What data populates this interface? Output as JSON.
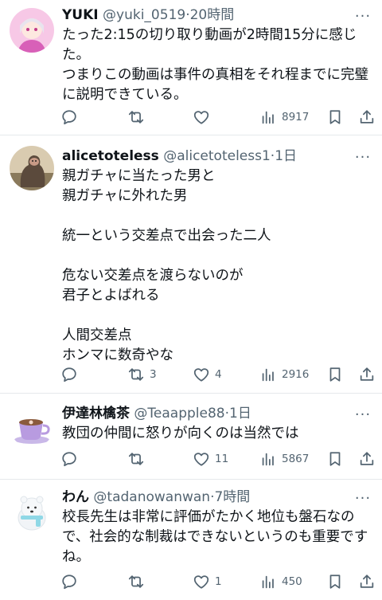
{
  "tweets": [
    {
      "name": "YUKI",
      "handle": "@yuki_0519",
      "time": "20時間",
      "lines": [
        "たった2:15の切り取り動画が2時間15分に感じ",
        "た。",
        "つまりこの動画は事件の真相をそれ程までに完璧",
        "に説明できている。"
      ],
      "replies": "",
      "retweets": "",
      "likes": "",
      "views": "8917"
    },
    {
      "name": "alicetoteless",
      "handle": "@alicetoteless1",
      "time": "1日",
      "lines": [
        "親ガチャに当たった男と",
        "親ガチャに外れた男",
        "",
        "統一という交差点で出会った二人",
        "",
        "危ない交差点を渡らないのが",
        "君子とよばれる",
        "",
        "人間交差点",
        "ホンマに数奇やな"
      ],
      "replies": "",
      "retweets": "3",
      "likes": "4",
      "views": "2916"
    },
    {
      "name": "伊達林檎茶",
      "handle": "@Teaapple88",
      "time": "1日",
      "lines": [
        "教団の仲間に怒りが向くのは当然では"
      ],
      "replies": "",
      "retweets": "",
      "likes": "11",
      "views": "5867"
    },
    {
      "name": "わん",
      "handle": "@tadanowanwan",
      "time": "7時間",
      "lines": [
        "校長先生は非常に評価がたかく地位も盤石なの",
        "で、社会的な制裁はできないというのも重要です",
        "ね。"
      ],
      "replies": "",
      "retweets": "",
      "likes": "1",
      "views": "450"
    }
  ],
  "separator": "·",
  "icons": [
    "reply-icon",
    "retweet-icon",
    "like-icon",
    "views-icon",
    "bookmark-icon",
    "share-icon",
    "more-icon"
  ],
  "colors": {
    "text": "#0f1419",
    "secondary": "#536471",
    "divider": "#e6e9ec"
  }
}
